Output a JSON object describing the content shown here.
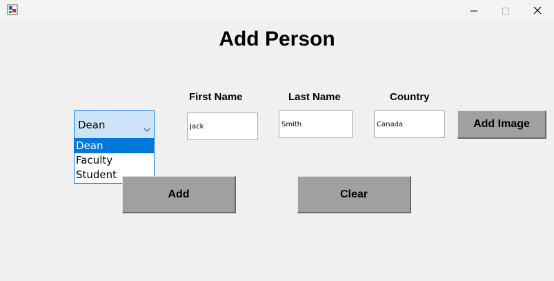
{
  "window": {
    "icons": {
      "app": "java-app-icon",
      "minimize": "minimize-icon",
      "maximize": "maximize-icon",
      "close": "close-icon"
    }
  },
  "form": {
    "title": "Add Person",
    "role_select": {
      "selected": "Dean",
      "options": [
        "Dean",
        "Faculty",
        "Student"
      ],
      "highlighted_index": 0,
      "arrow_icon": "chevron-down-icon"
    },
    "first_name": {
      "label": "First Name",
      "value": "Jack"
    },
    "last_name": {
      "label": "Last Name",
      "value": "Smith"
    },
    "country": {
      "label": "Country",
      "value": "Canada"
    },
    "buttons": {
      "add_image": "Add Image",
      "add": "Add",
      "clear": "Clear"
    }
  },
  "colors": {
    "window_bg": "#f0f0f0",
    "button_bg": "#a0a0a0",
    "combo_bg": "#cce4f7",
    "accent": "#0078d7"
  }
}
